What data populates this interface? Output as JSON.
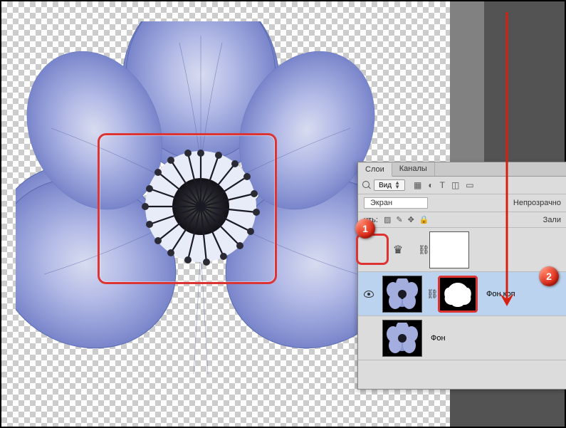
{
  "tabs": {
    "layers": "Слои",
    "channels": "Каналы"
  },
  "kind": {
    "label": "Вид"
  },
  "blend": {
    "mode": "Экран",
    "opacity_label": "Непрозрачно"
  },
  "lock": {
    "prefix": "ить:",
    "fill_label": "Зали"
  },
  "layers": [
    {
      "name": "",
      "has_mask": true,
      "visible": false
    },
    {
      "name": "Фон коп",
      "selected": true,
      "has_mask": true,
      "visible": true
    },
    {
      "name": "Фон",
      "visible": false
    }
  ],
  "annotations": {
    "badge1": "1",
    "badge2": "2"
  }
}
